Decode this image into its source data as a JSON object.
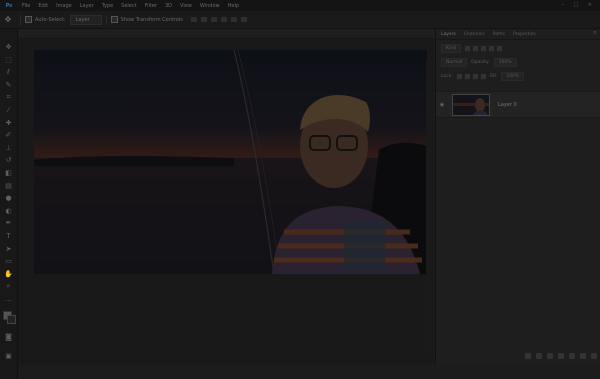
{
  "menubar": {
    "logo": "Ps",
    "items": [
      "File",
      "Edit",
      "Image",
      "Layer",
      "Type",
      "Select",
      "Filter",
      "3D",
      "View",
      "Window",
      "Help"
    ],
    "window_controls": "– □ ✕"
  },
  "options_bar": {
    "tool_glyph": "✥",
    "auto_select_label": "Auto-Select:",
    "auto_select_value": "Layer",
    "show_transform_label": "Show Transform Controls"
  },
  "toolbar": {
    "tools": [
      {
        "name": "move-tool-icon",
        "glyph": "✥"
      },
      {
        "name": "marquee-tool-icon",
        "glyph": "⬚"
      },
      {
        "name": "lasso-tool-icon",
        "glyph": "ℓ"
      },
      {
        "name": "quick-select-tool-icon",
        "glyph": "✎"
      },
      {
        "name": "crop-tool-icon",
        "glyph": "⌗"
      },
      {
        "name": "eyedropper-tool-icon",
        "glyph": "⁄"
      },
      {
        "name": "healing-tool-icon",
        "glyph": "✚"
      },
      {
        "name": "brush-tool-icon",
        "glyph": "✐"
      },
      {
        "name": "stamp-tool-icon",
        "glyph": "⊥"
      },
      {
        "name": "history-brush-tool-icon",
        "glyph": "↺"
      },
      {
        "name": "eraser-tool-icon",
        "glyph": "◧"
      },
      {
        "name": "gradient-tool-icon",
        "glyph": "▤"
      },
      {
        "name": "blur-tool-icon",
        "glyph": "●"
      },
      {
        "name": "dodge-tool-icon",
        "glyph": "◐"
      },
      {
        "name": "pen-tool-icon",
        "glyph": "✒"
      },
      {
        "name": "type-tool-icon",
        "glyph": "T"
      },
      {
        "name": "path-select-tool-icon",
        "glyph": "➤"
      },
      {
        "name": "shape-tool-icon",
        "glyph": "▭"
      },
      {
        "name": "hand-tool-icon",
        "glyph": "✋"
      },
      {
        "name": "zoom-tool-icon",
        "glyph": "⌕"
      },
      {
        "name": "more-tools-icon",
        "glyph": "…"
      }
    ],
    "bottom_tools": [
      {
        "name": "quick-mask-icon",
        "glyph": "◙"
      },
      {
        "name": "screen-mode-icon",
        "glyph": "▣"
      }
    ]
  },
  "document": {
    "tab_label": ""
  },
  "panel": {
    "tabs": [
      "Layers",
      "Channels",
      "Paths",
      "Properties"
    ],
    "menu_glyph": "≡",
    "kind_label": "Kind",
    "blend_mode": "Normal",
    "opacity_label": "Opacity:",
    "opacity_value": "100%",
    "lock_label": "Lock:",
    "fill_label": "Fill:",
    "fill_value": "100%",
    "layers": [
      {
        "name": "Layer 0",
        "visible": true
      }
    ],
    "footer_icons": [
      "link-icon",
      "fx-icon",
      "mask-icon",
      "adjustment-icon",
      "group-icon",
      "new-layer-icon",
      "trash-icon"
    ]
  },
  "colors": {
    "chrome_dark": "#1c1c1c",
    "menubar": "#141414",
    "panel": "#1e1e1e",
    "accent": "#3a6ea5"
  }
}
